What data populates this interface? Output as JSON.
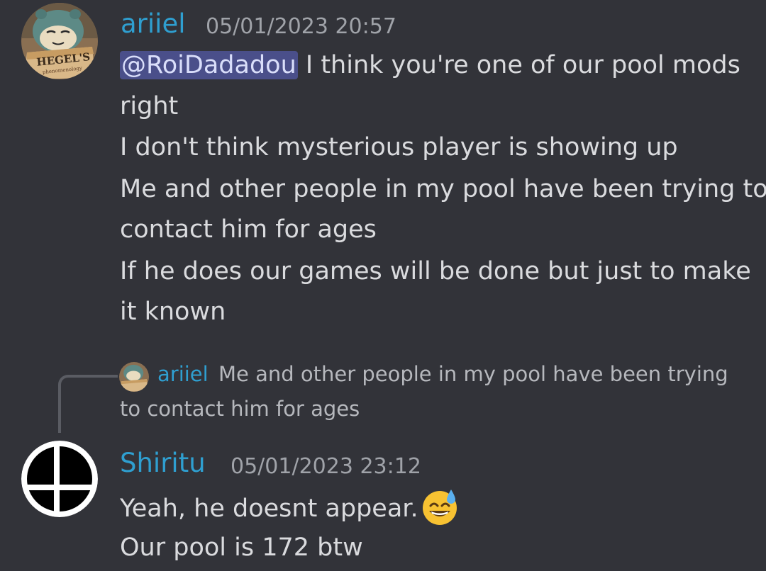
{
  "messages": [
    {
      "author": "ariiel",
      "timestamp": "05/01/2023 20:57",
      "avatar": "snorlax-reading-book-avatar",
      "mention": "@RoiDadadou",
      "lines": [
        " I think you're one of our pool mods",
        "right",
        "I don't think mysterious player is showing up",
        "Me and other people in my pool have been trying to",
        "contact him for ages",
        "If he does our games will be done but just to make",
        "it known"
      ]
    },
    {
      "reply_to": {
        "author": "ariiel",
        "text_line1": "Me and other people in my pool have been trying",
        "text_line2": "to contact him for ages"
      },
      "author": "Shiritu",
      "timestamp": "05/01/2023 23:12",
      "avatar": "smash-bros-logo-avatar",
      "lines": [
        "Yeah, he doesnt appear.",
        "Our pool is 172 btw"
      ],
      "emoji": "sweat-smile-emoji"
    }
  ],
  "colors": {
    "background": "#323339",
    "username": "#2f9fd0",
    "text": "#dadbde",
    "timestamp": "#a0a3a9",
    "mention_bg": "#4a4f8a"
  }
}
